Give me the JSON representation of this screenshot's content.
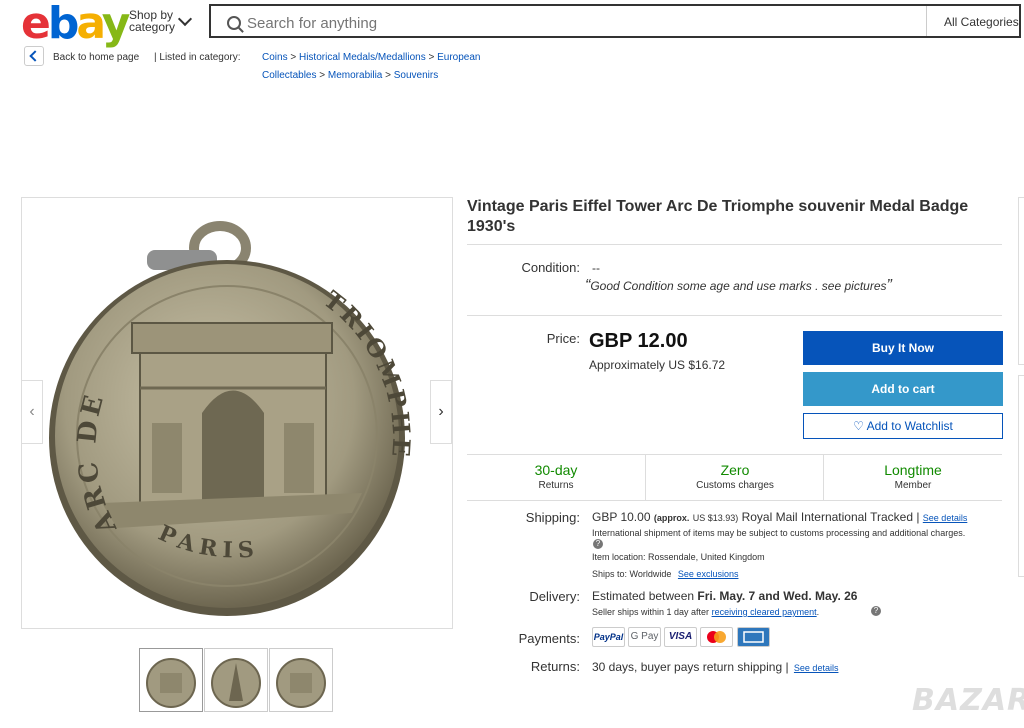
{
  "header": {
    "logo": {
      "e": "e",
      "b": "b",
      "a": "a",
      "y": "y"
    },
    "shop_by_line1": "Shop by",
    "shop_by_line2": "category",
    "search_placeholder": "Search for anything",
    "all_categories": "All Categories"
  },
  "breadcrumb": {
    "back_label": "Back to home page",
    "listed_in": "| Listed in category:",
    "items": [
      "Coins",
      "Historical Medals/Medallions",
      "European",
      "Collectables",
      "Memorabilia",
      "Souvenirs"
    ],
    "sep": ">"
  },
  "product": {
    "title": "Vintage Paris Eiffel Tower Arc De Triomphe souvenir Medal Badge 1930's",
    "condition_label": "Condition:",
    "condition_value": "--",
    "condition_note": "Good Condition some age and use marks . see pictures",
    "quote_open": "“",
    "quote_close": "”",
    "price_label": "Price:",
    "price": "GBP 12.00",
    "approx": "Approximately US $16.72",
    "buy_now": "Buy It Now",
    "add_to_cart": "Add to cart",
    "watchlist": "Add to Watchlist"
  },
  "features": [
    {
      "title": "30-day",
      "sub": "Returns"
    },
    {
      "title": "Zero",
      "sub": "Customs charges"
    },
    {
      "title": "Longtime",
      "sub": "Member"
    }
  ],
  "shipping": {
    "label": "Shipping:",
    "cost": "GBP 10.00",
    "approx": "(approx.",
    "approx_us": "US $13.93)",
    "service": "Royal Mail International Tracked |",
    "see_details": "See details",
    "intl_note": "International shipment of items may be subject to customs processing and additional charges.",
    "location_label": "Item location:",
    "location": "Rossendale, United Kingdom",
    "ships_to_label": "Ships to:",
    "ships_to": "Worldwide",
    "see_exclusions": "See exclusions"
  },
  "delivery": {
    "label": "Delivery:",
    "estimated": "Estimated between",
    "dates": "Fri. May. 7 and Wed. May. 26",
    "note_prefix": "Seller ships within 1 day after",
    "note_link": "receiving cleared payment",
    "note_suffix": "."
  },
  "payments": {
    "label": "Payments:",
    "methods": [
      "PayPal",
      "G Pay",
      "VISA",
      "",
      ""
    ]
  },
  "returns": {
    "label": "Returns:",
    "text": "30 days, buyer pays return shipping |",
    "see_details": "See details"
  },
  "medal": {
    "left_text": "ARC DE",
    "right_text": "TRIOMPHE",
    "bottom_text": "PARIS"
  },
  "watermark": "BAZAR",
  "colors": {
    "buy_now": "#0654ba",
    "add_to_cart": "#3498ca",
    "feature_green": "#118a00"
  }
}
